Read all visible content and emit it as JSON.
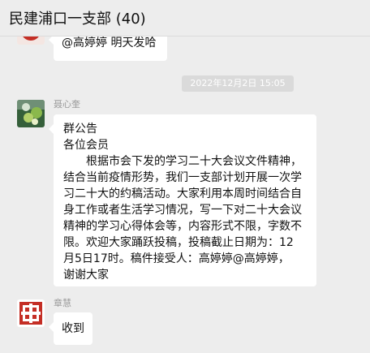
{
  "header": {
    "title": "民建浦口一支部 (40)"
  },
  "messages": {
    "prev": {
      "text": "@高婷婷 明天发哈"
    },
    "timestamp": "2022年12月2日 15:05",
    "notice": {
      "sender": "聂心奎",
      "lines": [
        "群公告",
        "各位会员",
        "根据市会下发的学习二十大会议文件精神，",
        "结合当前疫情形势，我们一支部计划开展一次学",
        "习二十大的约稿活动。大家利用本周时间结合自",
        "身工作或者生活学习情况，写一下对二十大会议",
        "精神的学习心得体会等，内容形式不限，字数不",
        "限。欢迎大家踊跃投稿，投稿截止日期为：12",
        "月5日17时。稿件接受人：高婷婷@高婷婷，",
        "谢谢大家"
      ]
    },
    "reply": {
      "sender": "章慧",
      "text": "收到"
    }
  },
  "colors": {
    "background": "#ededed",
    "bubble": "#ffffff",
    "timestamp_bg": "#dadada"
  }
}
